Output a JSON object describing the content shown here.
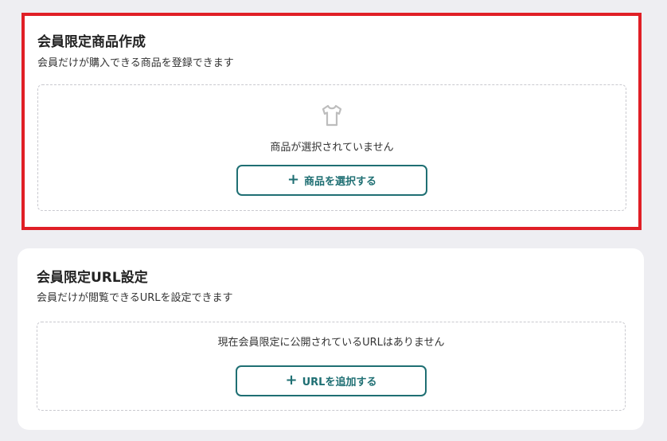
{
  "products_section": {
    "title": "会員限定商品作成",
    "description": "会員だけが購入できる商品を登録できます",
    "empty_message": "商品が選択されていません",
    "empty_icon": "t-shirt-icon",
    "button_label": "商品を選択する",
    "button_icon": "+"
  },
  "urls_section": {
    "title": "会員限定URL設定",
    "description": "会員だけが閲覧できるURLを設定できます",
    "empty_message": "現在会員限定に公開されているURLはありません",
    "button_label": "URLを追加する",
    "button_icon": "+"
  },
  "colors": {
    "accent": "#1f6f73",
    "highlight_border": "#e01f26",
    "background": "#eeeef2",
    "icon_gray": "#bdbdbd"
  }
}
